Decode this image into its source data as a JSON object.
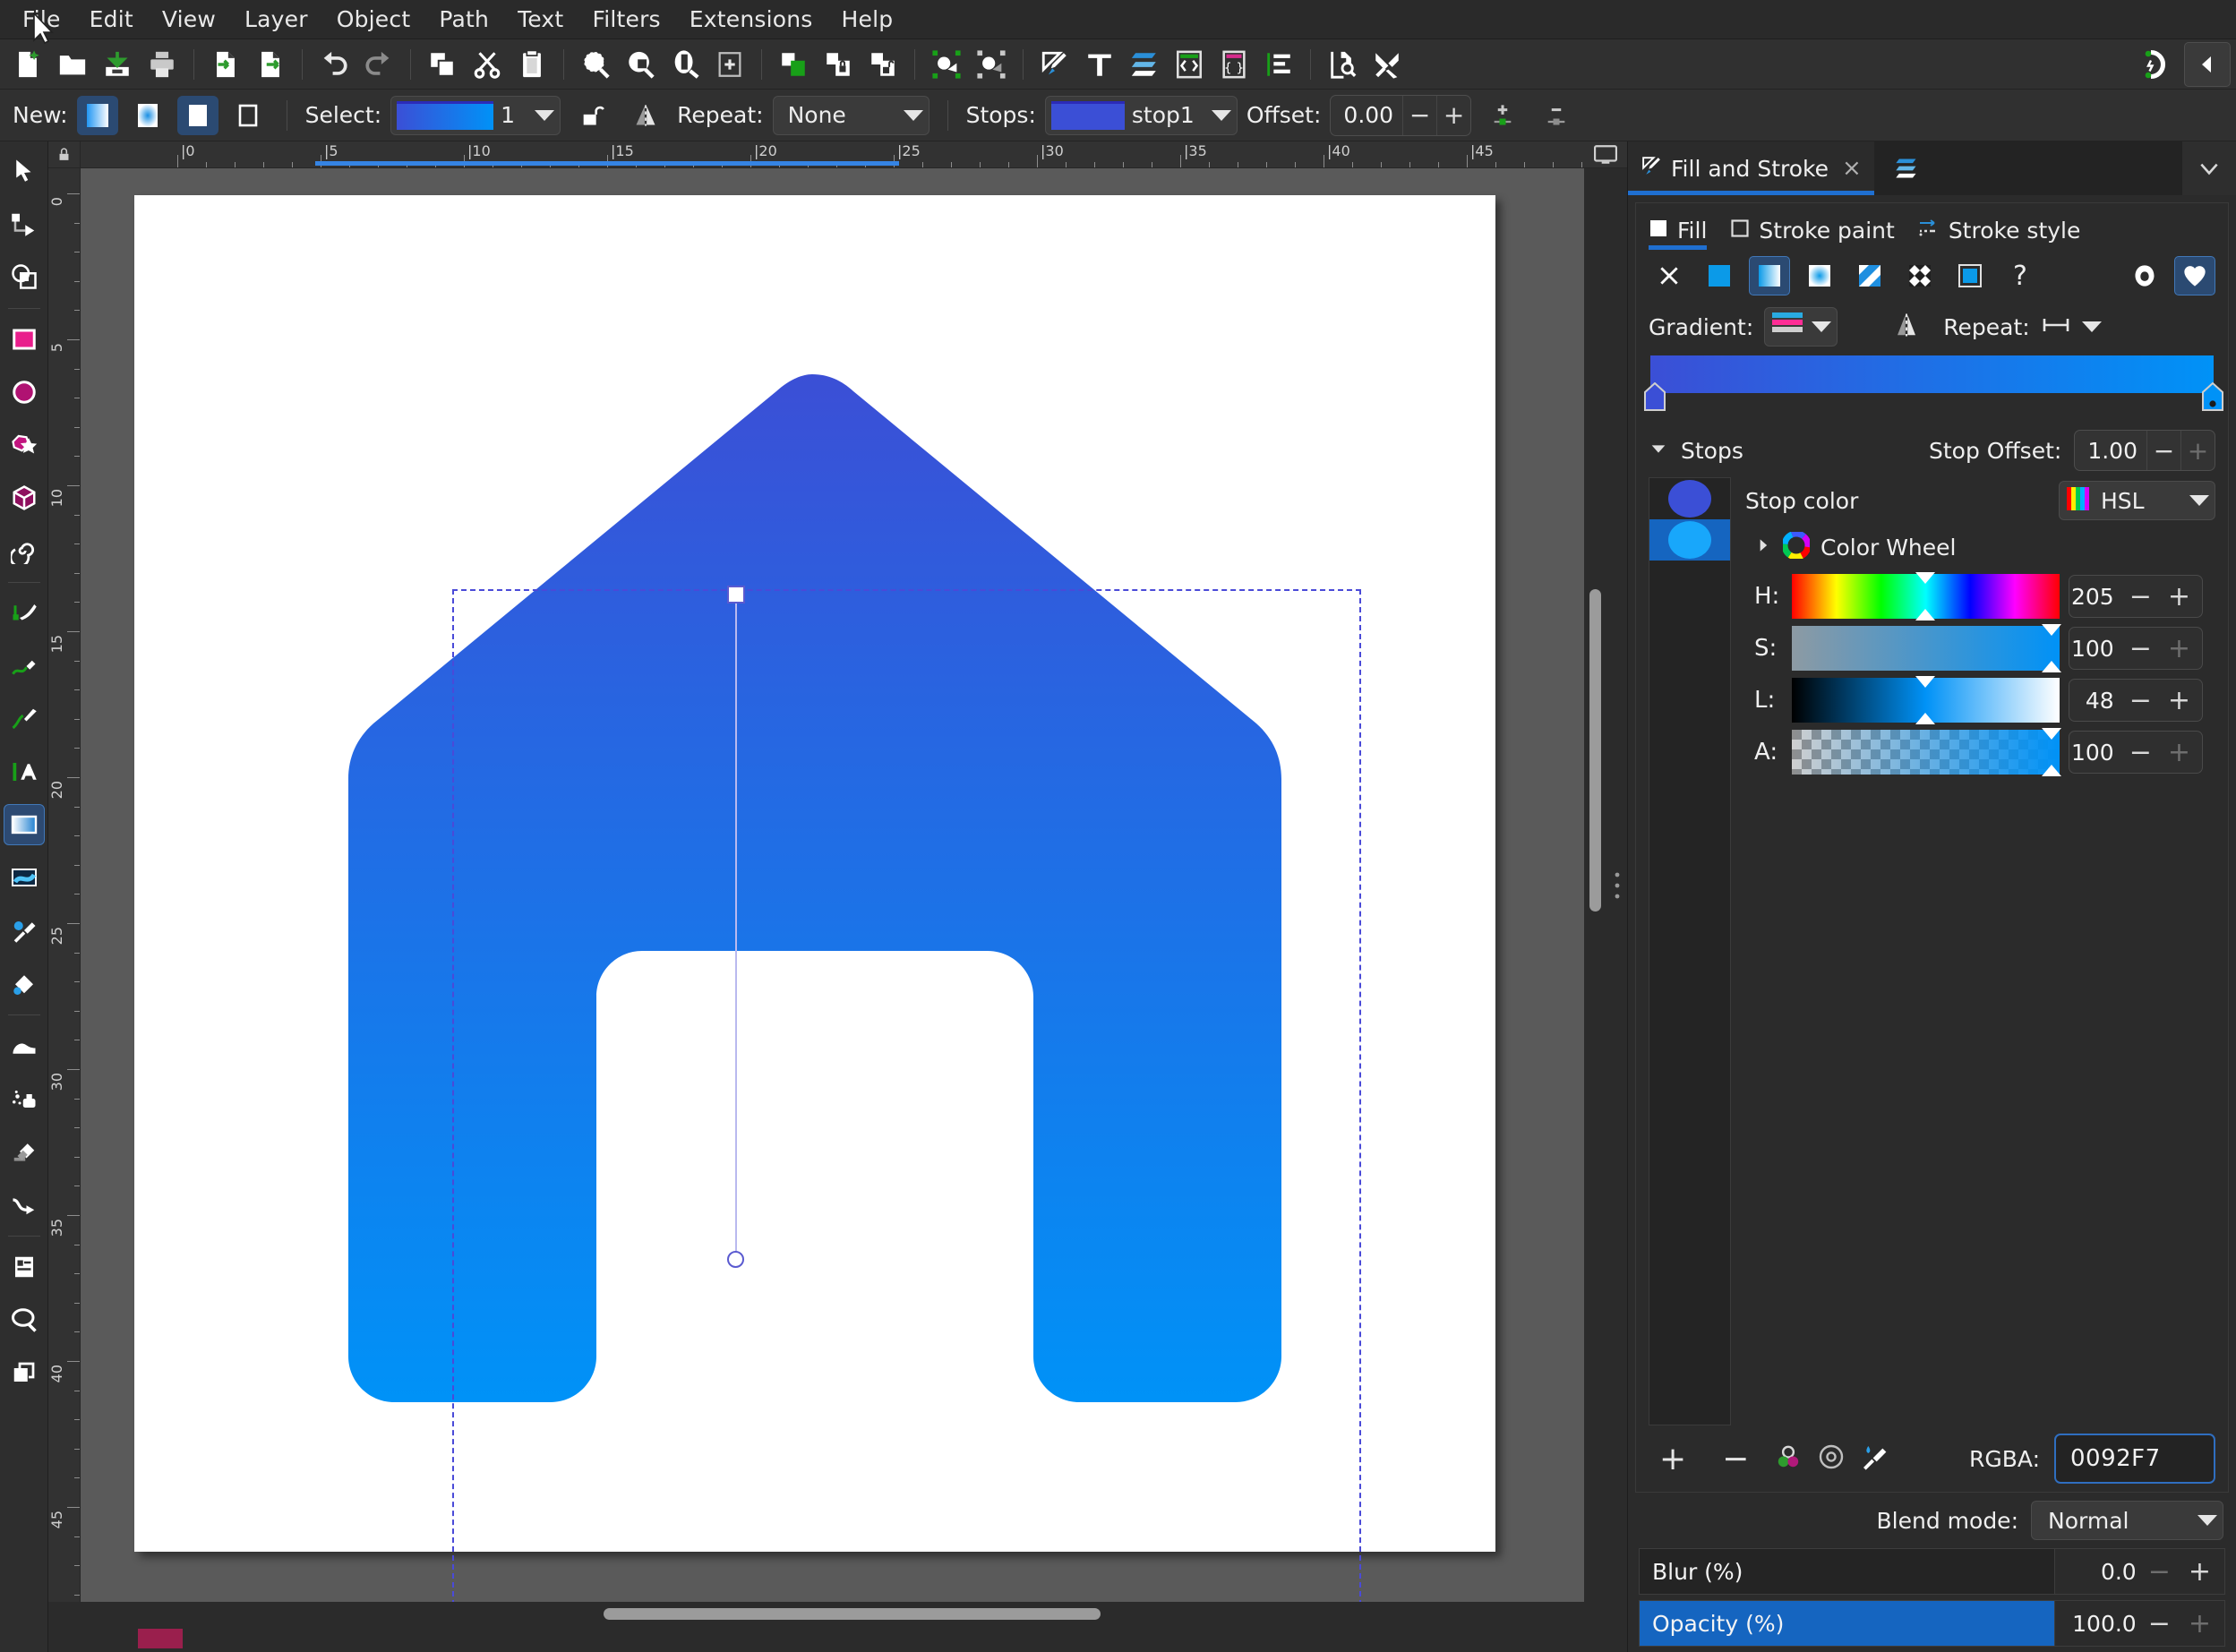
{
  "menu": {
    "items": [
      "File",
      "Edit",
      "View",
      "Layer",
      "Object",
      "Path",
      "Text",
      "Filters",
      "Extensions",
      "Help"
    ]
  },
  "commands": {
    "icons": [
      "new-document-icon",
      "open-document-icon",
      "save-document-icon",
      "print-icon",
      "import-icon",
      "export-icon",
      "undo-icon",
      "redo-icon",
      "copy-icon",
      "cut-icon",
      "paste-icon",
      "zoom-selection-icon",
      "zoom-drawing-icon",
      "zoom-page-icon",
      "zoom-fit-icon",
      "group-icon",
      "lock-group-icon",
      "unlock-group-icon",
      "objects-selected-icon",
      "objects-deselected-icon",
      "fill-stroke-dialog-icon",
      "text-tool-dialog-icon",
      "layers-dialog-icon",
      "xml-editor-icon",
      "selectors-icon",
      "objects-panel-icon",
      "preferences-document-icon",
      "preferences-icon",
      "snap-controls-icon",
      "collapse-panel-icon"
    ],
    "panel_toggle": "collapse-panel-icon"
  },
  "tooloptions": {
    "new_label": "New:",
    "new_modes": [
      "linear-gradient-icon",
      "radial-gradient-icon",
      "fill-target-icon",
      "stroke-target-icon"
    ],
    "select_label": "Select:",
    "select_value": "1",
    "lock_icon": "unlocked-icon",
    "reverse_icon": "reverse-gradient-icon",
    "repeat_label": "Repeat:",
    "repeat_value": "None",
    "stops_label": "Stops:",
    "stops_value": "stop1",
    "stops_swatch": "#3b4fd6",
    "offset_label": "Offset:",
    "offset_value": "0.00",
    "insert_stop_icon": "insert-stop-icon",
    "delete_stop_icon": "delete-stop-icon"
  },
  "toolbox": {
    "tools": [
      {
        "name": "selector-tool",
        "icon": "arrow-cursor-icon",
        "selected": false
      },
      {
        "name": "node-tool",
        "icon": "node-editor-icon",
        "selected": false
      },
      {
        "name": "boolean-tool",
        "icon": "boolean-ops-icon",
        "selected": false
      },
      {
        "name": "rectangle-tool",
        "icon": "rectangle-icon",
        "selected": false
      },
      {
        "name": "ellipse-tool",
        "icon": "ellipse-icon",
        "selected": false
      },
      {
        "name": "star-tool",
        "icon": "star-icon",
        "selected": false
      },
      {
        "name": "box3d-tool",
        "icon": "cube-3d-icon",
        "selected": false
      },
      {
        "name": "spiral-tool",
        "icon": "spiral-icon",
        "selected": false
      },
      {
        "name": "pen-tool",
        "icon": "bezier-pen-icon",
        "selected": false
      },
      {
        "name": "pencil-tool",
        "icon": "pencil-icon",
        "selected": false
      },
      {
        "name": "calligraphy-tool",
        "icon": "calligraphy-brush-icon",
        "selected": false
      },
      {
        "name": "text-tool",
        "icon": "text-a-icon",
        "selected": false
      },
      {
        "name": "gradient-tool",
        "icon": "linear-gradient-icon",
        "selected": true
      },
      {
        "name": "mesh-tool",
        "icon": "mesh-gradient-icon",
        "selected": false
      },
      {
        "name": "dropper-tool",
        "icon": "eyedropper-icon",
        "selected": false
      },
      {
        "name": "paint-bucket-tool",
        "icon": "paint-bucket-icon",
        "selected": false
      },
      {
        "name": "tweak-tool",
        "icon": "tweak-icon",
        "selected": false
      },
      {
        "name": "spray-tool",
        "icon": "spray-can-icon",
        "selected": false
      },
      {
        "name": "eraser-tool",
        "icon": "eraser-icon",
        "selected": false
      },
      {
        "name": "connector-tool",
        "icon": "connector-icon",
        "selected": false
      },
      {
        "name": "pages-tool",
        "icon": "page-icon",
        "selected": false
      },
      {
        "name": "zoom-tool",
        "icon": "magnifier-icon",
        "selected": false
      },
      {
        "name": "measure-tool",
        "icon": "copies-icon",
        "selected": false
      }
    ]
  },
  "rulers": {
    "h_labels": [
      "0",
      "5",
      "10",
      "15",
      "20",
      "25",
      "30",
      "35",
      "40",
      "45"
    ],
    "v_labels": [
      "0",
      "5",
      "10",
      "15",
      "20",
      "25",
      "30",
      "35",
      "40",
      "45"
    ],
    "units": "mm"
  },
  "canvas": {
    "shape_name": "house-icon-path",
    "gradient_start": "#3b4fd6",
    "gradient_end": "#0092f7"
  },
  "dock": {
    "tab_title": "Fill and Stroke",
    "tab_close": "×",
    "tab_icon": "fill-stroke-icon",
    "second_tab_icon": "layers-icon",
    "chevron_icon": "chevron-down-icon"
  },
  "fillstroke": {
    "tabs": [
      {
        "label": "Fill",
        "icon": "fill-square-icon",
        "active": true
      },
      {
        "label": "Stroke paint",
        "icon": "stroke-square-icon",
        "active": false
      },
      {
        "label": "Stroke style",
        "icon": "stroke-style-icon",
        "active": false
      }
    ],
    "paint_types": [
      {
        "name": "no-paint-icon",
        "active": false
      },
      {
        "name": "flat-color-icon",
        "active": false
      },
      {
        "name": "linear-gradient-icon",
        "active": true
      },
      {
        "name": "radial-gradient-icon",
        "active": false
      },
      {
        "name": "mesh-gradient-icon",
        "active": false
      },
      {
        "name": "pattern-icon",
        "active": false
      },
      {
        "name": "swatch-icon",
        "active": false
      },
      {
        "name": "unknown-paint-icon",
        "active": false
      }
    ],
    "fillrules": [
      {
        "name": "even-odd-fillrule-icon",
        "active": false
      },
      {
        "name": "nonzero-fillrule-icon",
        "active": true
      }
    ],
    "gradient_label": "Gradient:",
    "gradient_preview_icon": "gradient-list-icon",
    "edit_gradient_icon": "reverse-gradient-icon",
    "repeat_label": "Repeat:",
    "repeat_icon": "repeat-none-icon",
    "stops_header": "Stops",
    "stop_offset_label": "Stop Offset:",
    "stop_offset_value": "1.00",
    "stop_color_label": "Stop color",
    "color_mode": "HSL",
    "color_mode_icon": "color-spectrum-icon",
    "color_wheel_label": "Color Wheel",
    "color_wheel_icon": "color-wheel-icon",
    "expander_icon": "chevron-right-icon",
    "stops": [
      {
        "name": "stop1",
        "color": "#3b4fd6",
        "selected": false
      },
      {
        "name": "stop2",
        "color": "#0092f7",
        "selected": true
      }
    ],
    "hsl": [
      {
        "label": "H:",
        "value": "205"
      },
      {
        "label": "S:",
        "value": "100"
      },
      {
        "label": "L:",
        "value": "48"
      },
      {
        "label": "A:",
        "value": "100"
      }
    ],
    "stop_actions": [
      "add-stop-icon",
      "remove-stop-icon",
      "color-managed-icon",
      "reset-icon",
      "pick-color-icon"
    ],
    "rgba_label": "RGBA:",
    "rgba_value": "0092F7",
    "blend_mode_label": "Blend mode:",
    "blend_mode_value": "Normal",
    "blur": {
      "label": "Blur (%)",
      "value": "0.0",
      "fill_pct": 0
    },
    "opacity": {
      "label": "Opacity (%)",
      "value": "100.0",
      "fill_pct": 100
    }
  }
}
